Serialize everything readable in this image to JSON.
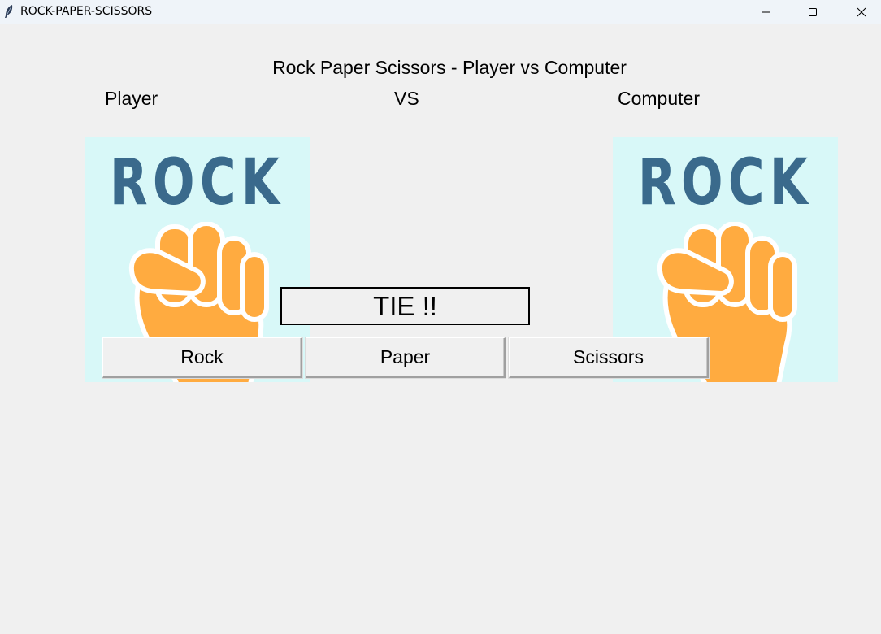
{
  "window": {
    "title": "ROCK-PAPER-SCISSORS",
    "icon": "feather-icon",
    "controls": [
      "minimize-icon",
      "maximize-icon",
      "close-icon"
    ]
  },
  "heading": "Rock Paper Scissors - Player vs Computer",
  "labels": {
    "player": "Player",
    "vs": "VS",
    "computer": "Computer"
  },
  "player_card": {
    "word": "ROCK",
    "icon": "fist-icon"
  },
  "computer_card": {
    "word": "ROCK",
    "icon": "fist-icon"
  },
  "result": "TIE !!",
  "buttons": {
    "rock": "Rock",
    "paper": "Paper",
    "scissors": "Scissors"
  },
  "colors": {
    "card_background": "#d8f8f8",
    "word_color": "#3a6a8c",
    "fist_color": "#ffab40"
  }
}
